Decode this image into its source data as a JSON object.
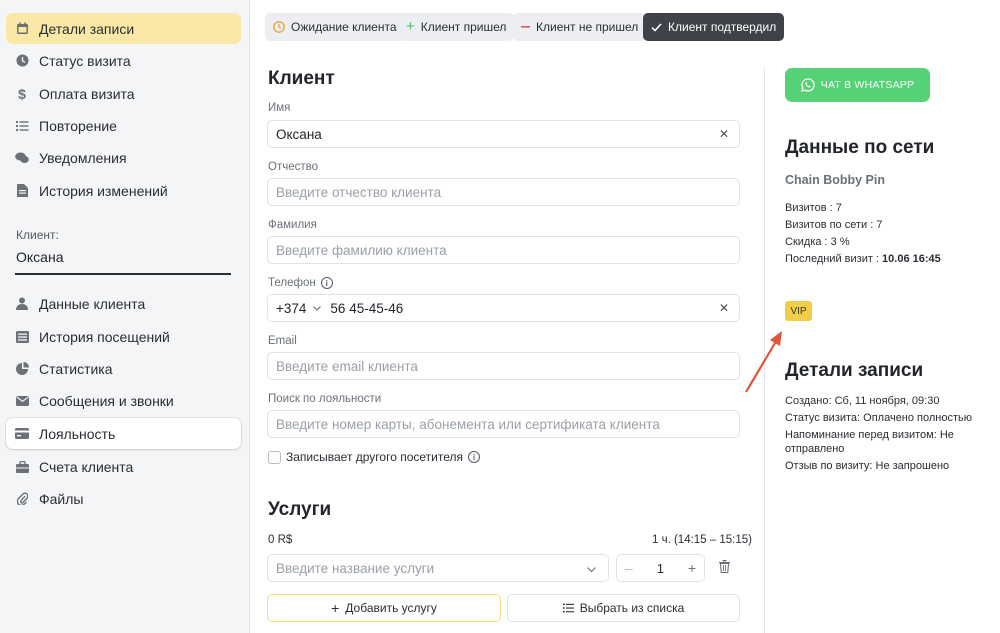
{
  "sidebar": {
    "items_top": [
      {
        "label": "Детали записи",
        "icon": "calendar-icon"
      },
      {
        "label": "Статус визита",
        "icon": "clock-icon"
      },
      {
        "label": "Оплата визита",
        "icon": "dollar-icon"
      },
      {
        "label": "Повторение",
        "icon": "list-icon"
      },
      {
        "label": "Уведомления",
        "icon": "chat-icon"
      },
      {
        "label": "История изменений",
        "icon": "document-icon"
      }
    ],
    "client_caption": "Клиент:",
    "client_name": "Оксана",
    "items_bottom": [
      {
        "label": "Данные клиента",
        "icon": "user-icon"
      },
      {
        "label": "История посещений",
        "icon": "list-box-icon"
      },
      {
        "label": "Статистика",
        "icon": "pie-chart-icon"
      },
      {
        "label": "Сообщения и звонки",
        "icon": "envelope-icon"
      },
      {
        "label": "Лояльность",
        "icon": "card-icon"
      },
      {
        "label": "Счета клиента",
        "icon": "briefcase-icon"
      },
      {
        "label": "Файлы",
        "icon": "paperclip-icon"
      }
    ]
  },
  "status_buttons": [
    {
      "label": "Ожидание клиента",
      "icon": "clock-icon"
    },
    {
      "label": "Клиент пришел",
      "icon": "plus-icon"
    },
    {
      "label": "Клиент не пришел",
      "icon": "minus-icon"
    },
    {
      "label": "Клиент подтвердил",
      "icon": "check-icon"
    }
  ],
  "client_form": {
    "title": "Клиент",
    "first_name": {
      "label": "Имя",
      "value": "Оксана"
    },
    "middle_name": {
      "label": "Отчество",
      "placeholder": "Введите отчество клиента"
    },
    "last_name": {
      "label": "Фамилия",
      "placeholder": "Введите фамилию клиента"
    },
    "phone": {
      "label": "Телефон",
      "country_code": "+374",
      "value": "56 45-45-46"
    },
    "email": {
      "label": "Email",
      "placeholder": "Введите email клиента"
    },
    "loyalty": {
      "label": "Поиск по лояльности",
      "placeholder": "Введите номер карты, абонемента или сертификата клиента"
    },
    "other_visitor_label": "Записывает другого посетителя"
  },
  "services": {
    "title": "Услуги",
    "total": "0 R$",
    "duration": "1 ч. (14:15 – 15:15)",
    "service_placeholder": "Введите название услуги",
    "quantity": "1",
    "add_label": "Добавить услугу",
    "pick_label": "Выбрать из списка"
  },
  "right_panel": {
    "whatsapp_label": "ЧАТ В WHATSAPP",
    "network_title": "Данные по сети",
    "chain_name": "Chain Bobby Pin",
    "visits": "Визитов : 7",
    "network_visits": "Визитов по сети : 7",
    "discount": "Скидка : 3 %",
    "last_visit_label": "Последний визит : ",
    "last_visit_value": "10.06 16:45",
    "badge": "VIP",
    "details_title": "Детали записи",
    "created": "Создано: Сб, 11 ноября, 09:30",
    "visit_status": "Статус визита: Оплачено полностью",
    "reminder": "Напоминание перед визитом: Не отправлено",
    "feedback": "Отзыв по визиту: Не запрошено"
  },
  "colors": {
    "active_nav": "#fbe8a6",
    "whatsapp": "#55d275",
    "vip": "#f2cd47",
    "confirmed_button": "#3f4249",
    "arrow": "#e0553a"
  }
}
